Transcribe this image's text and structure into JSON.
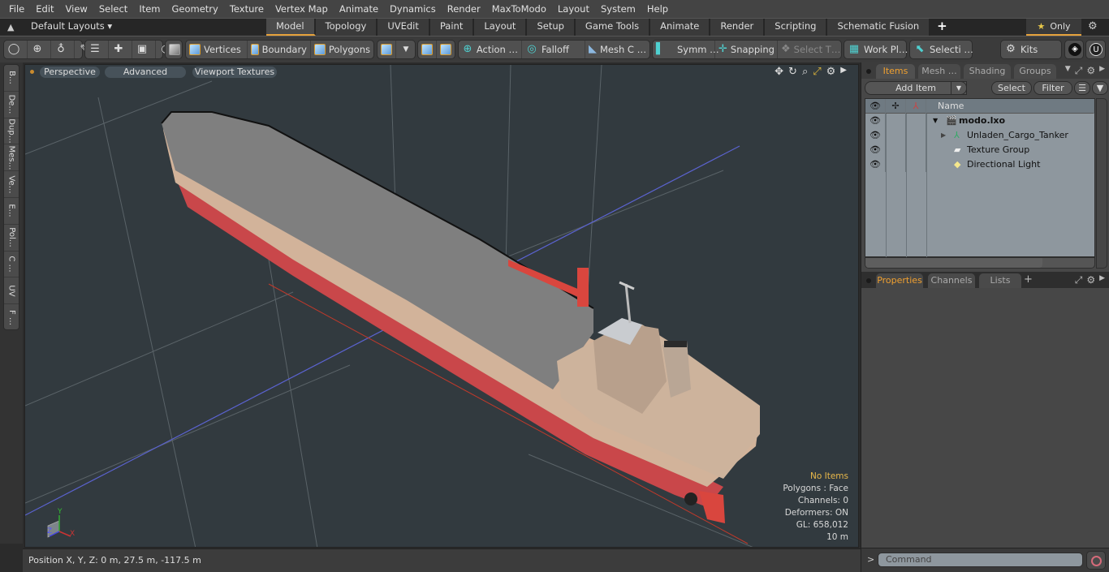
{
  "menubar": {
    "items": [
      "File",
      "Edit",
      "View",
      "Select",
      "Item",
      "Geometry",
      "Texture",
      "Vertex Map",
      "Animate",
      "Dynamics",
      "Render",
      "MaxToModo",
      "Layout",
      "System",
      "Help"
    ]
  },
  "layoutbar": {
    "layouts_label": "Default Layouts ▾",
    "tabs": [
      "Model",
      "Topology",
      "UVEdit",
      "Paint",
      "Layout",
      "Setup",
      "Game Tools",
      "Animate",
      "Render",
      "Scripting",
      "Schematic Fusion"
    ],
    "active_tab": "Model",
    "only_label": "Only",
    "plus": "+"
  },
  "toolbar": {
    "vertices": "Vertices",
    "boundary": "Boundary",
    "polygons": "Polygons",
    "action": "Action  …",
    "falloff": "Falloff",
    "mesh": "Mesh C …",
    "symmetry": "Symm …",
    "snapping": "Snapping",
    "select_t": "Select T…",
    "work_plane": "Work Pl…",
    "selection": "Selecti …",
    "kits": "Kits"
  },
  "left_tabs": [
    "B…",
    "De…",
    "Dup…",
    "Mes…",
    "Ve…",
    "E…",
    "Pol…",
    "C …",
    "UV",
    "F …"
  ],
  "viewport": {
    "perspective": "Perspective",
    "advanced": "Advanced",
    "textures": "Viewport Textures",
    "info": {
      "selection": "No Items",
      "polygons": "Polygons : Face",
      "channels": "Channels: 0",
      "deformers": "Deformers: ON",
      "gl": "GL: 658,012",
      "scale": "10 m"
    },
    "axis": {
      "x": "X",
      "y": "Y",
      "z": "Z"
    }
  },
  "status": {
    "position": "Position X, Y, Z:   0 m, 27.5 m, -117.5 m"
  },
  "items_panel": {
    "tabs": [
      "Items",
      "Mesh …",
      "Shading",
      "Groups"
    ],
    "active_tab": "Items",
    "add_item": "Add Item",
    "select": "Select",
    "filter": "Filter",
    "name_header": "Name",
    "tree": [
      {
        "label": "modo.lxo",
        "icon": "scene-clapper-icon",
        "bold": true
      },
      {
        "label": "Unladen_Cargo_Tanker",
        "icon": "mesh-locator-icon"
      },
      {
        "label": "Texture Group",
        "icon": "folder-icon"
      },
      {
        "label": "Directional Light",
        "icon": "light-icon"
      }
    ]
  },
  "properties_panel": {
    "tabs": [
      "Properties",
      "Channels",
      "Lists"
    ],
    "active_tab": "Properties",
    "plus": "+"
  },
  "command": {
    "prompt": ">",
    "placeholder": "Command"
  }
}
